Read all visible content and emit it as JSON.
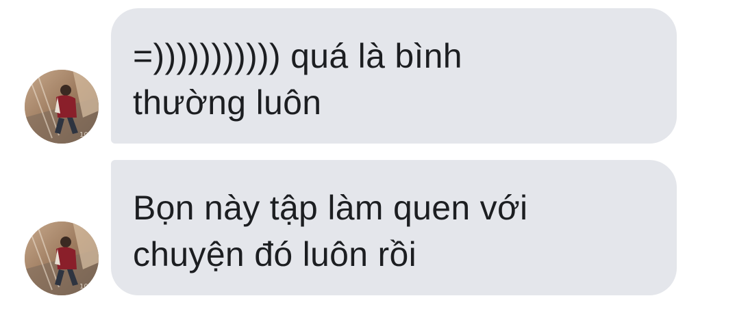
{
  "messages": [
    {
      "text": "=))))))))))) quá là bình\nthường luôn"
    },
    {
      "text": "Bọn này tập làm quen với\nchuyện đó luôn rồi"
    }
  ],
  "colors": {
    "bubble_bg": "#e4e6eb",
    "text": "#1c1e21",
    "background": "#ffffff"
  },
  "icons": {
    "avatar": "profile-photo-avatar"
  }
}
